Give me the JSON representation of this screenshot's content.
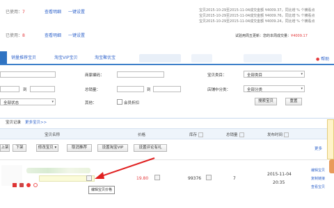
{
  "summary": {
    "row1": {
      "label": "已使用：",
      "count": "7",
      "link1": "查看明细",
      "link2": "一键设置"
    },
    "row2": {
      "label": "已使用：",
      "count": "8",
      "link1": "查看明细",
      "link2": "一键设置"
    },
    "notices": [
      "宝贝2015-10-29至2015-11-04成交金额 ¥4009.37，同比增 % 个横看点",
      "宝贝2015-10-29至2015-11-04成交金额 ¥4009.76，同比增 % 个横看点",
      "宝贝2015-10-29至2015-11-04成交金额 ¥4009.24，同比增 % 个横看点"
    ],
    "trial_text": "试验用周五更新：您的本周成交量：",
    "trial_value": "¥4009.17",
    "help_link": "帮助"
  },
  "tabs": [
    "销量推荐宝贝",
    "淘宝VIP宝贝",
    "淘宝聚优宝"
  ],
  "filters": {
    "row1_left_label": "",
    "row1_mid_label": "商家编码：",
    "row1_right_label": "宝贝类目：",
    "row1_right_value": "全部类目",
    "row2_range_sep": "到",
    "row2_mid_label": "总销量：",
    "row2_mid_sep": "到",
    "row2_right_label": "店铺中分类：",
    "row2_right_value": "全部分类",
    "row3_left_value": "全部状态",
    "row3_mid_label": "其他：",
    "row3_checkbox_label": "会员折扣",
    "search_button": "搜索宝贝",
    "reset_button": "重置"
  },
  "subnav": {
    "tab1": "宝贝记录",
    "tab2": "更多宝贝>>"
  },
  "columns": {
    "name": "宝贝名称",
    "price": "价格",
    "stock": "库存",
    "sales": "总销量",
    "publish_time": "发布时间"
  },
  "toolbar": {
    "b1": "上架",
    "b2": "下架",
    "b3": "修改宝贝",
    "b4": "取消推荐",
    "b5": "设置淘宝VIP",
    "b6": "设置评论有礼"
  },
  "row": {
    "price": "19.80",
    "stock": "99376",
    "sales": "7",
    "date": "2015-11-04",
    "time": "20:35",
    "act1": "编辑宝贝",
    "act2": "复制链接",
    "act3": "查看宝贝",
    "tooltip": "编辑宝贝价格"
  },
  "side": {
    "more_link": "更多"
  },
  "colors": {
    "accent": "#3366cc",
    "price_red": "#e4393c",
    "annotation_arrow": "#e02020"
  }
}
